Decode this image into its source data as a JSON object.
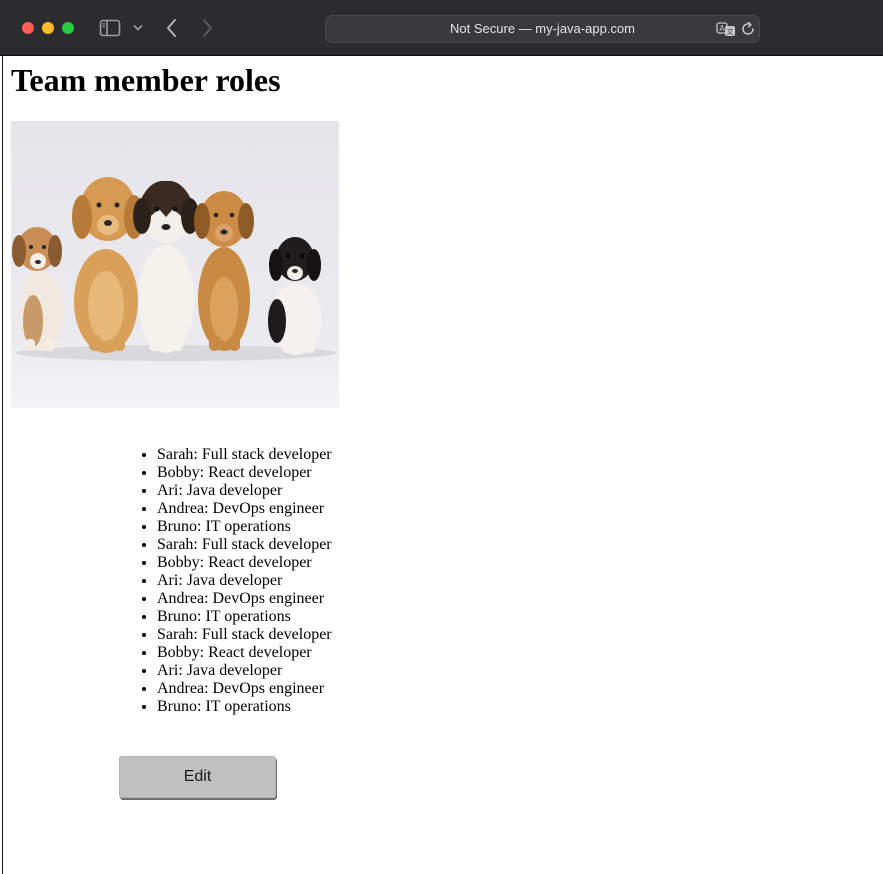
{
  "browser": {
    "address_text": "Not Secure — my-java-app.com"
  },
  "page": {
    "title": "Team member roles",
    "image_alt": "Five puppies sitting in a row",
    "roles": [
      "Sarah: Full stack developer",
      "Bobby: React developer",
      "Ari: Java developer",
      "Andrea: DevOps engineer",
      "Bruno: IT operations",
      "Sarah: Full stack developer",
      "Bobby: React developer",
      "Ari: Java developer",
      "Andrea: DevOps engineer",
      "Bruno: IT operations",
      "Sarah: Full stack developer",
      "Bobby: React developer",
      "Ari: Java developer",
      "Andrea: DevOps engineer",
      "Bruno: IT operations"
    ],
    "edit_label": "Edit"
  },
  "icons": {
    "sidebar": "sidebar-icon",
    "chevron": "chevron-down-icon",
    "back": "back-arrow-icon",
    "forward": "forward-arrow-icon",
    "translate": "translate-icon",
    "reload": "reload-icon"
  },
  "colors": {
    "toolbar_bg": "#2c2c2e",
    "address_bg": "#3a3a3c",
    "close": "#ff5f57",
    "minimize": "#febc2e",
    "zoom": "#28c840",
    "button_bg": "#c0c0c0"
  }
}
